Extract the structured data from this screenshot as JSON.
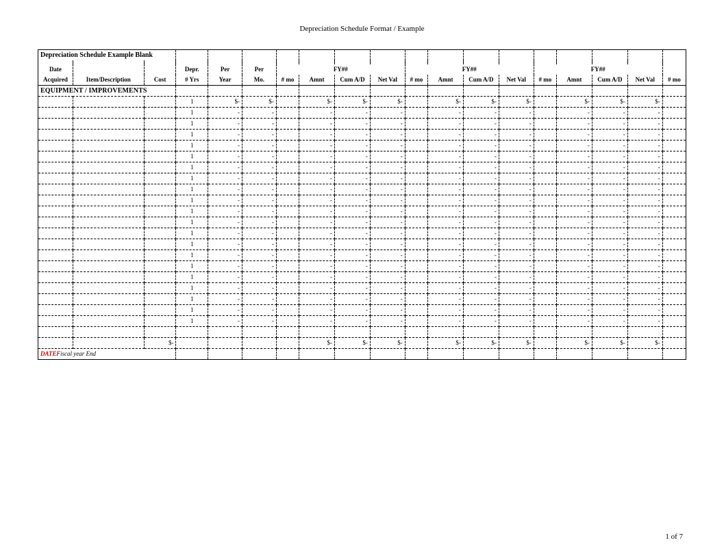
{
  "page_title": "Depreciation Schedule Format / Example",
  "table_title": "Depreciation Schedule Example Blank",
  "header1": {
    "date": "Date",
    "depr": "Depr.",
    "per1": "Per",
    "per2": "Per",
    "fy": "FY##"
  },
  "header2": {
    "acquired": "Acquired",
    "item": "Item/Description",
    "cost": "Cost",
    "yrs": "# Yrs",
    "year": "Year",
    "mo": "Mo.",
    "nmo": "# mo",
    "amnt": "Amnt",
    "cum": "Cum A/D",
    "net": "Net Val"
  },
  "section_label": "EQUIPMENT / IMPROVEMENTS",
  "rows": {
    "count": 21,
    "yrs_value": "1",
    "first_per_year": "$-",
    "first_per_mo": "$-",
    "other_per_year": "-",
    "other_per_mo": "-",
    "first_amnt": "$-",
    "other_amnt": "-",
    "first_cum": "$-",
    "other_cum": "-",
    "first_net": "$-",
    "other_net": "-"
  },
  "totals": {
    "cost": "$-",
    "amnt": "$-",
    "cum": "$-",
    "net": "$-"
  },
  "footer": {
    "date_label": "DATE",
    "fy_end": "Fiscal year End"
  },
  "page_number": "1 of 7"
}
